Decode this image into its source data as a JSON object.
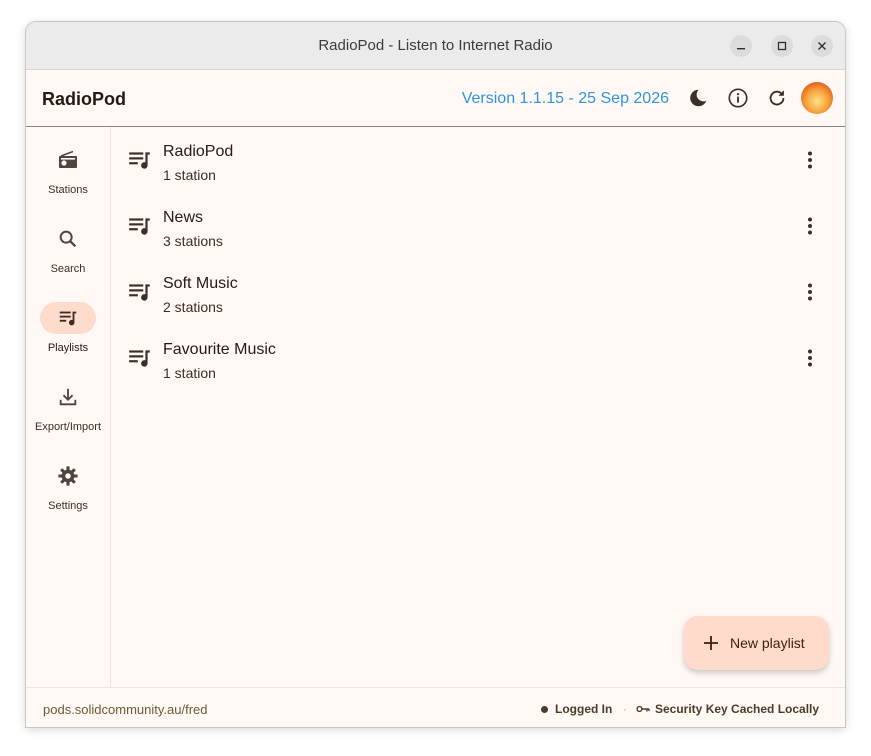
{
  "window": {
    "title": "RadioPod - Listen to Internet Radio"
  },
  "appbar": {
    "title": "RadioPod",
    "version": "Version 1.1.15 - 25 Sep 2026"
  },
  "rail": {
    "items": [
      {
        "label": "Stations",
        "icon": "radio-icon"
      },
      {
        "label": "Search",
        "icon": "search-icon"
      },
      {
        "label": "Playlists",
        "icon": "playlist-icon",
        "active": true
      },
      {
        "label": "Export/Import",
        "icon": "download-icon"
      },
      {
        "label": "Settings",
        "icon": "gear-icon"
      }
    ]
  },
  "playlists": [
    {
      "name": "RadioPod",
      "count": "1 station"
    },
    {
      "name": "News",
      "count": "3 stations"
    },
    {
      "name": "Soft Music",
      "count": "2 stations"
    },
    {
      "name": "Favourite Music",
      "count": "1 station"
    }
  ],
  "fab": {
    "label": "New playlist"
  },
  "footer": {
    "url": "pods.solidcommunity.au/fred",
    "login_status": "Logged In",
    "key_status": "Security Key Cached Locally"
  },
  "colors": {
    "accent": "#2e96d8",
    "active_bg": "#ffdbcb",
    "surface": "#fff8f5"
  }
}
